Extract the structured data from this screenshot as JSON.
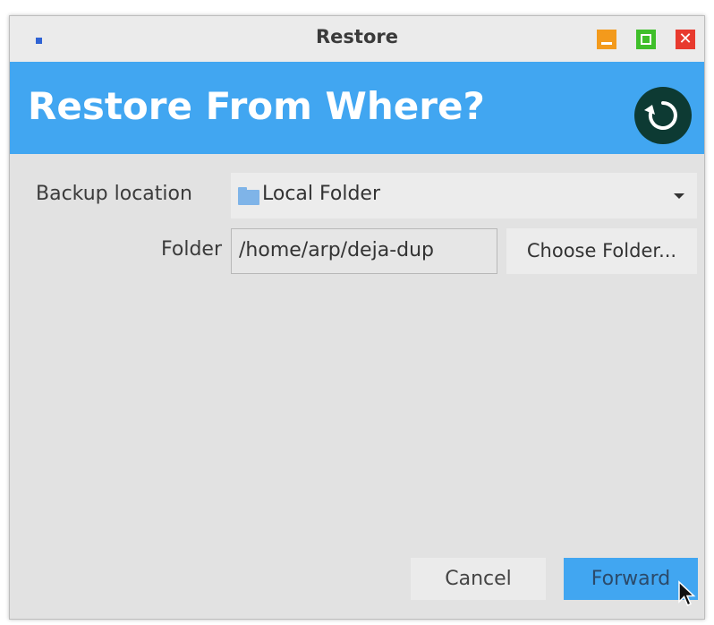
{
  "window": {
    "title": "Restore",
    "app_icon": "app-icon",
    "controls": {
      "minimize_icon": "minimize-icon",
      "maximize_icon": "maximize-icon",
      "close_icon": "close-icon",
      "close_glyph": "✕"
    }
  },
  "banner": {
    "heading": "Restore From Where?",
    "icon": "restore-icon",
    "color": "#41a6f1"
  },
  "form": {
    "backup_location_label": "Backup location",
    "backup_location_value": "Local Folder",
    "backup_location_icon": "folder-icon",
    "folder_label": "Folder",
    "folder_value": "/home/arp/deja-dup",
    "choose_folder_label": "Choose Folder..."
  },
  "footer": {
    "cancel_label": "Cancel",
    "forward_label": "Forward"
  },
  "colors": {
    "accent": "#41a6f1",
    "minimize": "#f39a1c",
    "maximize": "#3fbf2a",
    "close": "#e83a2e"
  }
}
